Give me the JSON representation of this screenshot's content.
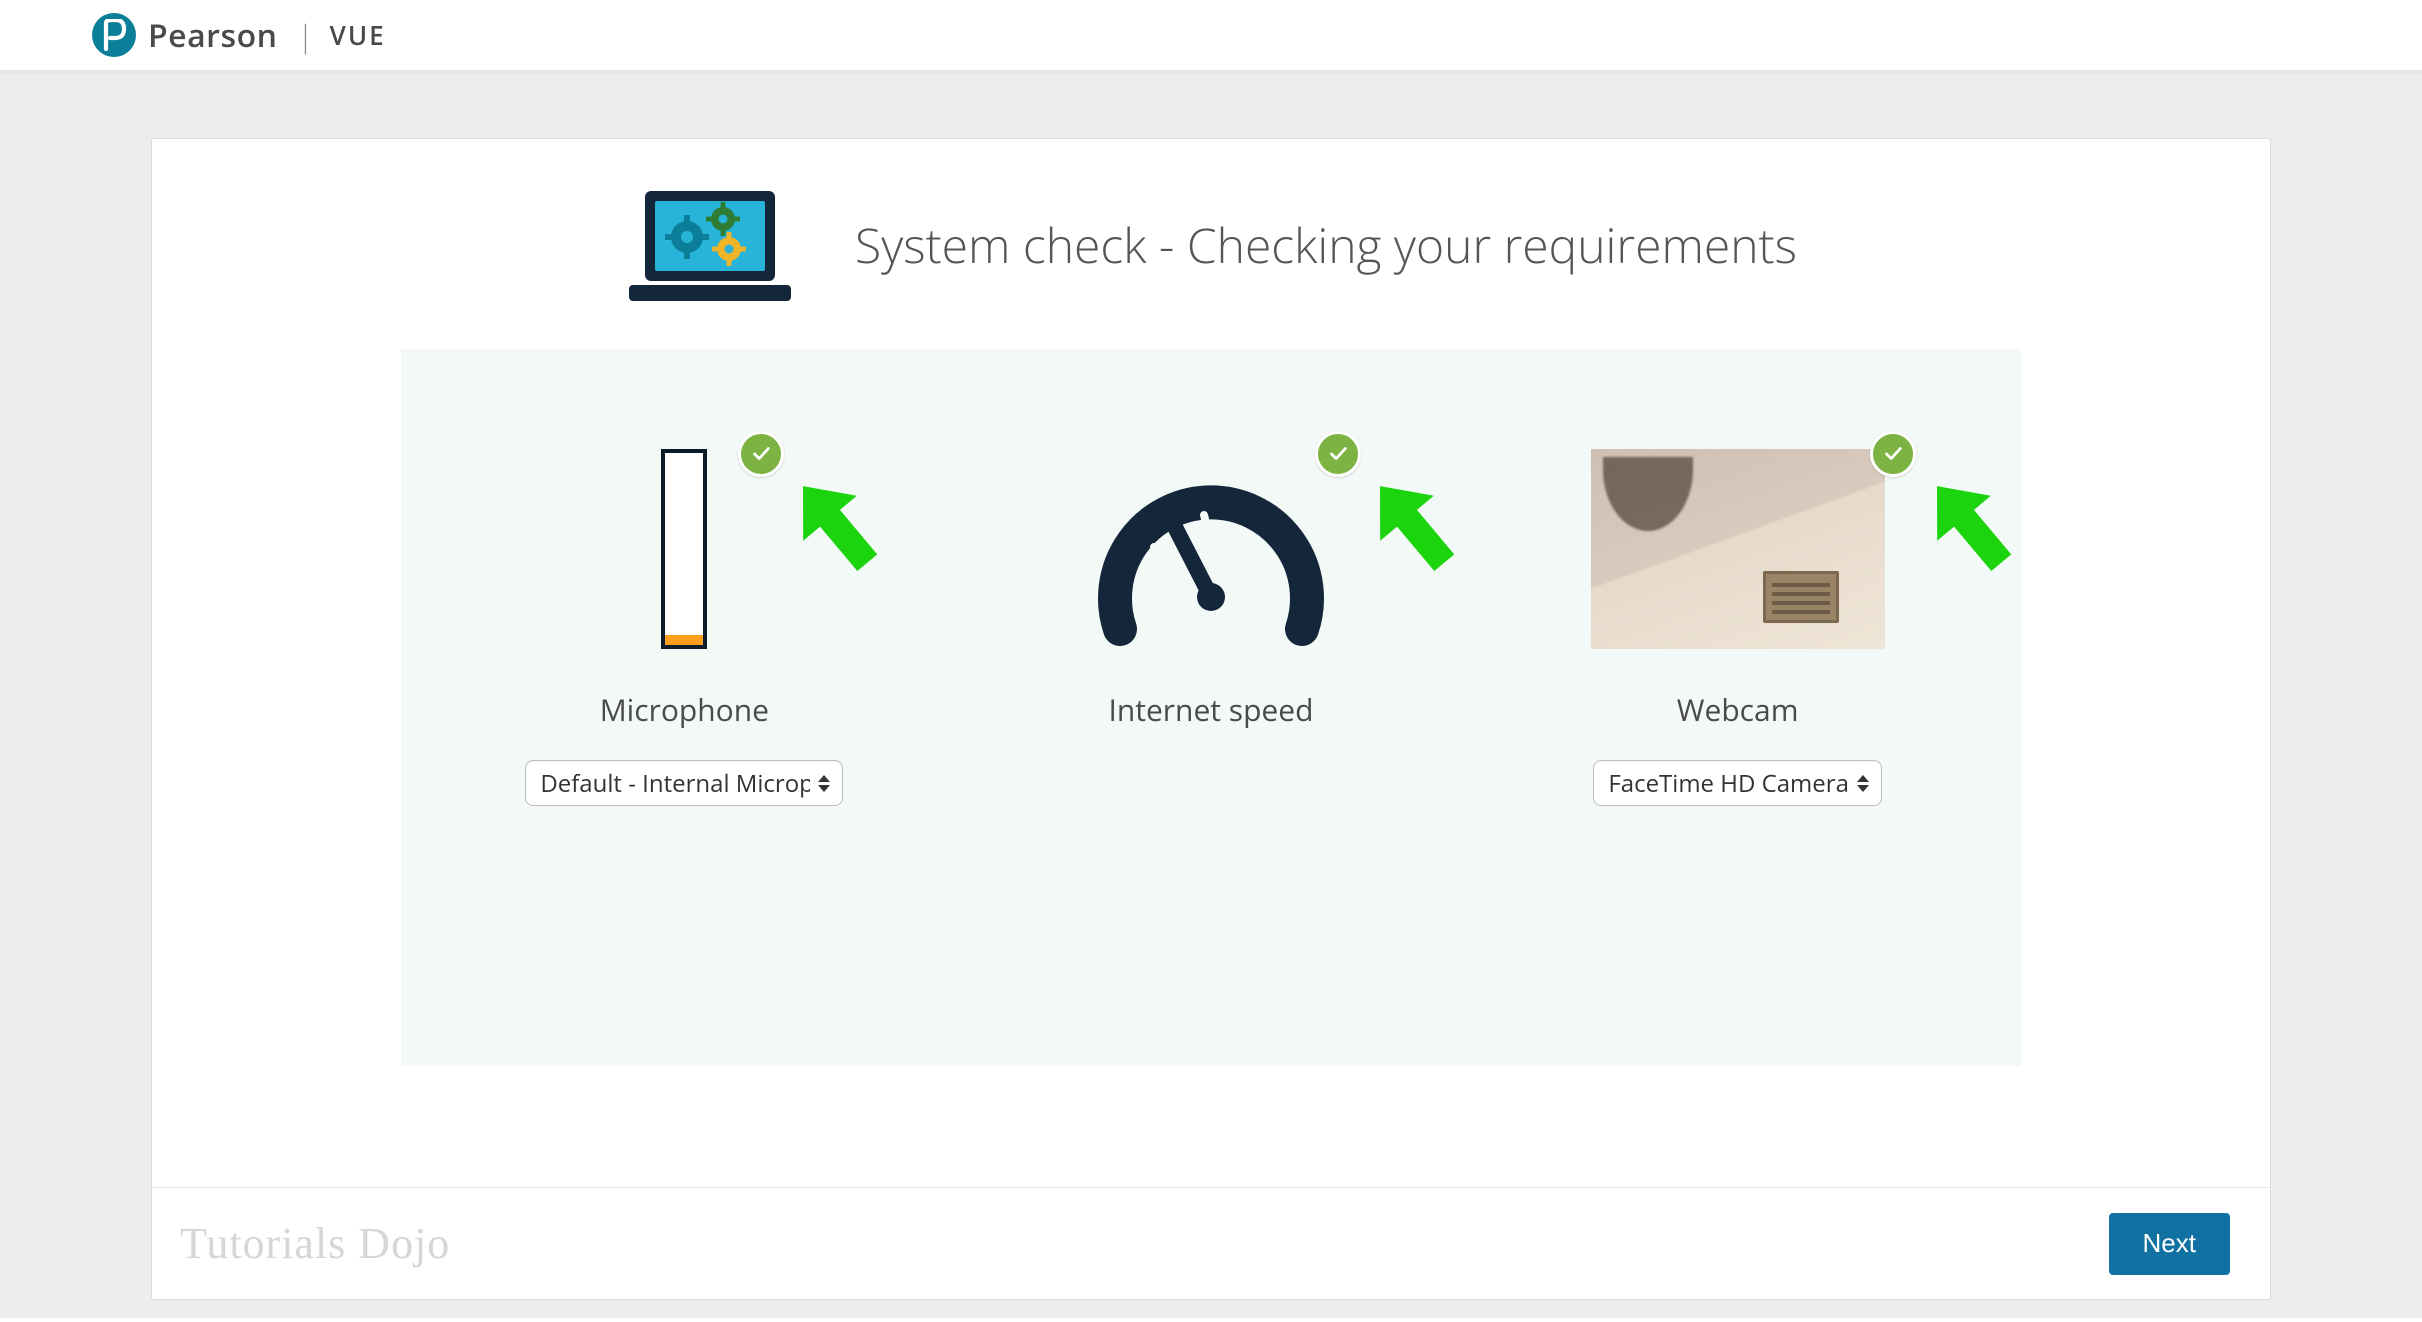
{
  "brand": {
    "name": "Pearson",
    "suffix": "VUE"
  },
  "page": {
    "title": "System check - Checking your requirements"
  },
  "checks": {
    "microphone": {
      "label": "Microphone",
      "status": "pass",
      "device_selected": "Default - Internal Microp"
    },
    "internet": {
      "label": "Internet speed",
      "status": "pass"
    },
    "webcam": {
      "label": "Webcam",
      "status": "pass",
      "device_selected": "FaceTime HD Camera"
    }
  },
  "footer": {
    "watermark": "Tutorials Dojo",
    "next_label": "Next"
  },
  "colors": {
    "brand_teal": "#0b7f99",
    "accent_blue": "#1171a3",
    "pass_green": "#7cb342",
    "panel_bg": "#f3f9f6",
    "dark_navy": "#14273a"
  }
}
